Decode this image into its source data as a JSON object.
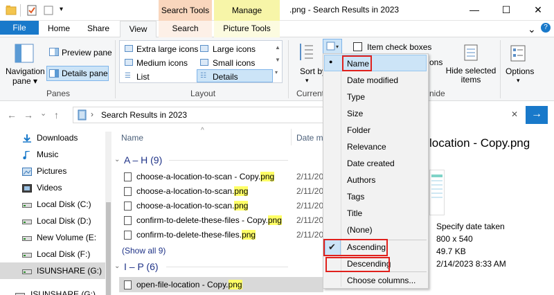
{
  "titlebar": {
    "title": ".png - Search Results in 2023",
    "context_tabs": {
      "search_tools": "Search Tools",
      "manage": "Manage"
    },
    "minimize": "—",
    "maximize": "☐",
    "close": "✕"
  },
  "ribbon_tabs": {
    "file": "File",
    "home": "Home",
    "share": "Share",
    "view": "View",
    "search": "Search",
    "picture_tools": "Picture Tools",
    "collapse": "⌄",
    "help": "?"
  },
  "ribbon": {
    "panes": {
      "navigation_pane": "Navigation pane ▾",
      "preview_pane": "Preview pane",
      "details_pane": "Details pane",
      "label": "Panes"
    },
    "layout": {
      "extra_large": "Extra large icons",
      "large": "Large icons",
      "medium": "Medium icons",
      "small": "Small icons",
      "list": "List",
      "details": "Details",
      "label": "Layout"
    },
    "current_view": {
      "sort_by": "Sort by",
      "label_partial": "Current",
      "item_check_boxes": "Item check boxes",
      "ons_partial": "ons"
    },
    "show_hide": {
      "hide_selected": "Hide selected items",
      "label_partial": "nide"
    },
    "options": "Options"
  },
  "address": {
    "path": "Search Results in 2023",
    "chevron": "›",
    "back": "←",
    "forward": "→",
    "up_caret": "⌄",
    "up": "↑",
    "close_search": "✕",
    "go": "→"
  },
  "nav": {
    "items": [
      {
        "label": "Downloads",
        "icon": "download-icon"
      },
      {
        "label": "Music",
        "icon": "music-icon"
      },
      {
        "label": "Pictures",
        "icon": "pictures-icon"
      },
      {
        "label": "Videos",
        "icon": "videos-icon"
      },
      {
        "label": "Local Disk (C:)",
        "icon": "drive-icon"
      },
      {
        "label": "Local Disk (D:)",
        "icon": "drive-icon"
      },
      {
        "label": "New Volume (E:",
        "icon": "drive-icon"
      },
      {
        "label": "Local Disk (F:)",
        "icon": "drive-icon"
      },
      {
        "label": "ISUNSHARE (G:)",
        "icon": "drive-icon"
      },
      {
        "label": "ISUNSHARE (G:)",
        "icon": "drive-icon"
      }
    ]
  },
  "filelist": {
    "col_name": "Name",
    "col_date_partial": "Date m",
    "sort_caret": "^",
    "groups": [
      {
        "title": "A – H (9)",
        "files": [
          {
            "name_pre": "choose-a-location-to-scan - Copy.",
            "name_hl": "png",
            "date": "2/11/20"
          },
          {
            "name_pre": "choose-a-location-to-scan.",
            "name_hl": "png",
            "date": "2/11/20"
          },
          {
            "name_pre": "choose-a-location-to-scan.",
            "name_hl": "png",
            "date": "2/11/20"
          },
          {
            "name_pre": "confirm-to-delete-these-files - Copy.",
            "name_hl": "png",
            "date": "2/11/20"
          },
          {
            "name_pre": "confirm-to-delete-these-files.",
            "name_hl": "png",
            "date": "2/11/20"
          }
        ],
        "show_all": "(Show all 9)"
      },
      {
        "title": "I – P (6)",
        "files": [
          {
            "name_pre": "open-file-location - Copy.",
            "name_hl": "png",
            "date": ""
          }
        ]
      }
    ]
  },
  "preview": {
    "title_partial": "location - Copy.png",
    "date_taken": "Specify date taken",
    "dimensions": "800 x 540",
    "size": "49.7 KB",
    "modified": "2/14/2023 8:33 AM"
  },
  "sort_menu": {
    "items": [
      "Name",
      "Date modified",
      "Type",
      "Size",
      "Folder",
      "Relevance",
      "Date created",
      "Authors",
      "Tags",
      "Title",
      "(None)"
    ],
    "order": [
      "Ascending",
      "Descending"
    ],
    "choose_columns": "Choose columns...",
    "selected_field": "Name",
    "selected_order": "Ascending",
    "bullet": "●",
    "check": "✔"
  },
  "colors": {
    "accent": "#1979ca",
    "search_tools": "#f9d6bd",
    "manage": "#f7f5a8",
    "highlight": "#ffff66",
    "annotation_red": "#e0201c"
  }
}
